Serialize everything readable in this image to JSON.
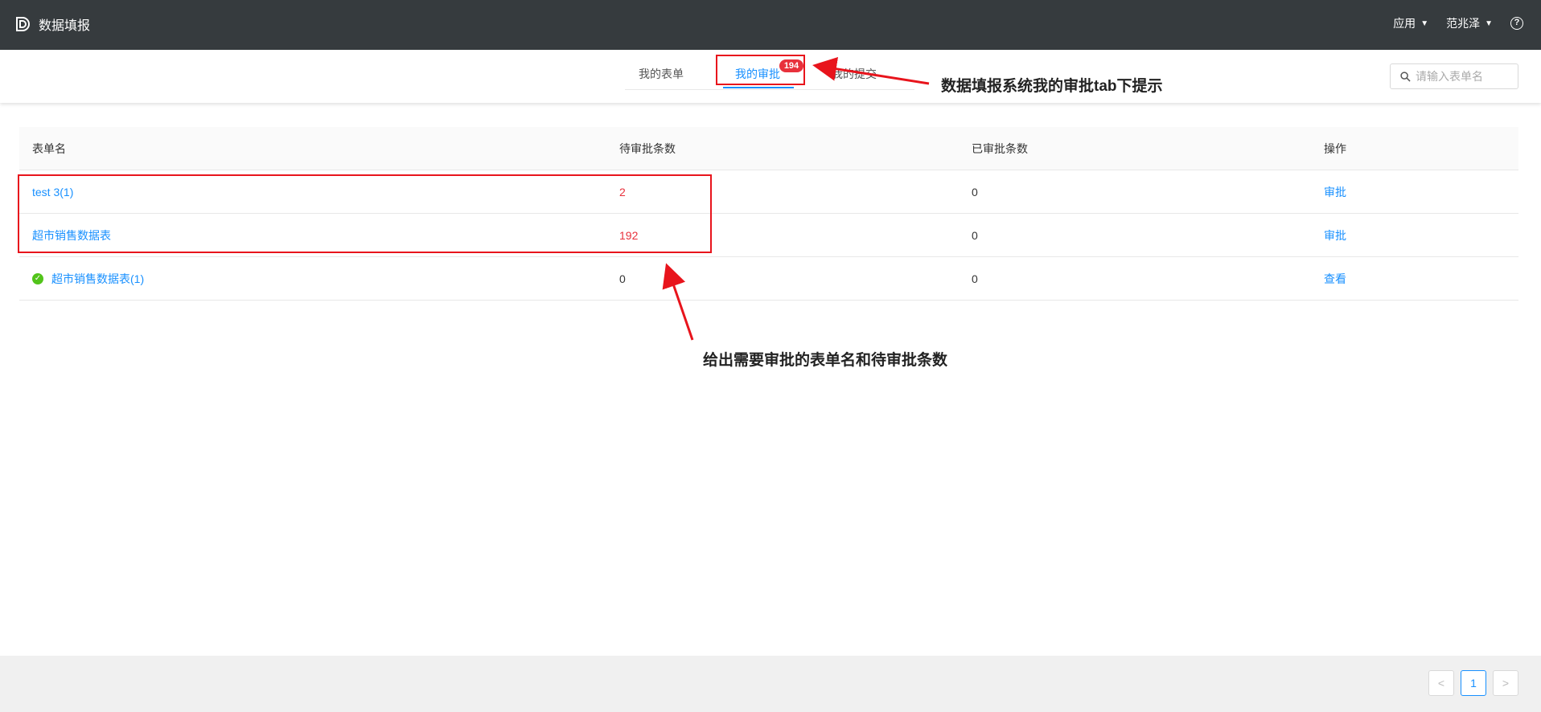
{
  "app": {
    "title": "数据填报"
  },
  "header": {
    "apps_menu": "应用",
    "user_menu": "范兆泽"
  },
  "tabs": [
    {
      "label": "我的表单",
      "active": false
    },
    {
      "label": "我的审批",
      "active": true,
      "badge": "194"
    },
    {
      "label": "我的提交",
      "active": false
    }
  ],
  "search": {
    "placeholder": "请输入表单名",
    "value": ""
  },
  "table": {
    "columns": [
      "表单名",
      "待审批条数",
      "已审批条数",
      "操作"
    ],
    "rows": [
      {
        "name": "test 3(1)",
        "pending": "2",
        "approved": "0",
        "action": "审批",
        "done": false
      },
      {
        "name": "超市销售数据表",
        "pending": "192",
        "approved": "0",
        "action": "审批",
        "done": false
      },
      {
        "name": "超市销售数据表(1)",
        "pending": "0",
        "approved": "0",
        "action": "查看",
        "done": true
      }
    ]
  },
  "pagination": {
    "current": "1",
    "prev_label": "<",
    "next_label": ">"
  },
  "annotations": {
    "tab_note": "数据填报系统我的审批tab下提示",
    "table_note": "给出需要审批的表单名和待审批条数"
  },
  "colors": {
    "topbar": "#363b3e",
    "accent": "#1890ff",
    "pending_red": "#e8313c",
    "annotation_red": "#e8141c",
    "success": "#52c41a"
  }
}
